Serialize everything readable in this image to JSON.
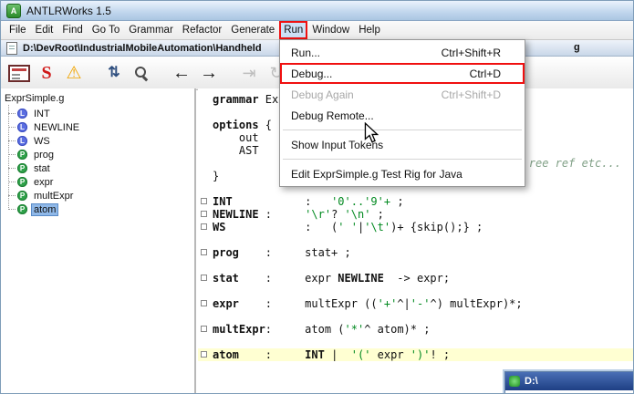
{
  "colors": {
    "annotation_red": "#f01010",
    "selection_blue": "#cde0f6",
    "tree_selection": "#8fb8e8",
    "line_highlight": "#ffffd2",
    "literal_green": "#00891f",
    "comment_green": "#7f9f85",
    "lexer_badge": "#5b6ee1",
    "parser_badge": "#2fa24a"
  },
  "window": {
    "title": "ANTLRWorks 1.5"
  },
  "menubar": {
    "items": [
      "File",
      "Edit",
      "Find",
      "Go To",
      "Grammar",
      "Refactor",
      "Generate",
      "Run",
      "Window",
      "Help"
    ],
    "selected": "Run"
  },
  "pathbar": {
    "path_left": "D:\\DevRoot\\IndustrialMobileAutomation\\Handheld",
    "path_right_fragment": "g"
  },
  "toolbar": {
    "icons": [
      {
        "name": "syntax-diagram-icon",
        "kind": "console"
      },
      {
        "name": "generate-code-icon",
        "kind": "glyph",
        "glyph": "S",
        "cls": "ic-s"
      },
      {
        "name": "warnings-icon",
        "kind": "glyph",
        "glyph": "⚠",
        "cls": "ic-warn"
      },
      {
        "name": "sort-rules-icon",
        "kind": "glyph",
        "glyph": "⇅",
        "cls": "ic-sort",
        "group": true
      },
      {
        "name": "search-icon",
        "kind": "mag"
      },
      {
        "name": "back-icon",
        "kind": "glyph",
        "glyph": "←",
        "cls": "ic-arrow",
        "group": true
      },
      {
        "name": "forward-icon",
        "kind": "glyph",
        "glyph": "→",
        "cls": "ic-arrow"
      },
      {
        "name": "debug-step-icon",
        "kind": "glyph",
        "glyph": "⇥",
        "cls": "ic-dis",
        "disabled": true,
        "group": true
      },
      {
        "name": "debug-rewind-icon",
        "kind": "glyph",
        "glyph": "↻",
        "cls": "ic-dis",
        "disabled": true
      }
    ]
  },
  "run_menu": {
    "items": [
      {
        "label": "Run...",
        "shortcut": "Ctrl+Shift+R"
      },
      {
        "label": "Debug...",
        "shortcut": "Ctrl+D",
        "highlight": true
      },
      {
        "label": "Debug Again",
        "shortcut": "Ctrl+Shift+D",
        "state": "disabled"
      },
      {
        "label": "Debug Remote...",
        "shortcut": ""
      },
      {
        "type": "separator"
      },
      {
        "label": "Show Input Tokens",
        "shortcut": ""
      },
      {
        "type": "separator"
      },
      {
        "label": "Edit ExprSimple.g Test Rig for Java",
        "shortcut": ""
      }
    ]
  },
  "rule_tree": {
    "root": "ExprSimple.g",
    "lexer_badge": "L",
    "parser_badge": "P",
    "items": [
      {
        "label": "INT",
        "kind": "lexer"
      },
      {
        "label": "NEWLINE",
        "kind": "lexer"
      },
      {
        "label": "WS",
        "kind": "lexer"
      },
      {
        "label": "prog",
        "kind": "parser"
      },
      {
        "label": "stat",
        "kind": "parser"
      },
      {
        "label": "expr",
        "kind": "parser"
      },
      {
        "label": "multExpr",
        "kind": "parser"
      },
      {
        "label": "atom",
        "kind": "parser",
        "selected": true
      }
    ]
  },
  "editor": {
    "lines": [
      {
        "segs": [
          {
            "t": "grammar",
            "c": "kw"
          },
          {
            "t": " Expr",
            "c": "pl"
          }
        ]
      },
      {
        "segs": []
      },
      {
        "segs": [
          {
            "t": "options",
            "c": "kw"
          },
          {
            "t": " {",
            "c": "pl"
          }
        ]
      },
      {
        "segs": [
          {
            "t": "    out",
            "c": "pl"
          }
        ]
      },
      {
        "segs": [
          {
            "t": "    AST",
            "c": "pl"
          }
        ]
      },
      {
        "segs": [
          {
            "t": "                                                ree ref etc...",
            "c": "cmt"
          }
        ]
      },
      {
        "segs": [
          {
            "t": "}",
            "c": "pl"
          }
        ]
      },
      {
        "segs": []
      },
      {
        "sq": true,
        "segs": [
          {
            "t": "INT",
            "c": "ref"
          },
          {
            "t": "           :   ",
            "c": "pl"
          },
          {
            "t": "'0'..'9'+",
            "c": "lit"
          },
          {
            "t": " ;",
            "c": "pl"
          }
        ]
      },
      {
        "sq": true,
        "segs": [
          {
            "t": "NEWLINE",
            "c": "ref"
          },
          {
            "t": " :     ",
            "c": "pl"
          },
          {
            "t": "'\\r'",
            "c": "lit"
          },
          {
            "t": "? ",
            "c": "pl"
          },
          {
            "t": "'\\n'",
            "c": "lit"
          },
          {
            "t": " ;",
            "c": "pl"
          }
        ]
      },
      {
        "sq": true,
        "segs": [
          {
            "t": "WS",
            "c": "ref"
          },
          {
            "t": "            :   ",
            "c": "pl"
          },
          {
            "t": "(",
            "c": "pl"
          },
          {
            "t": "' '",
            "c": "lit"
          },
          {
            "t": "|",
            "c": "pl"
          },
          {
            "t": "'\\t'",
            "c": "lit"
          },
          {
            "t": ")+ {skip();} ;",
            "c": "pl"
          }
        ]
      },
      {
        "segs": []
      },
      {
        "sq": true,
        "segs": [
          {
            "t": "prog",
            "c": "ref"
          },
          {
            "t": "    :     ",
            "c": "pl"
          },
          {
            "t": "stat+ ;",
            "c": "pl"
          }
        ]
      },
      {
        "segs": []
      },
      {
        "sq": true,
        "segs": [
          {
            "t": "stat",
            "c": "ref"
          },
          {
            "t": "    :     ",
            "c": "pl"
          },
          {
            "t": "expr ",
            "c": "pl"
          },
          {
            "t": "NEWLINE",
            "c": "ref"
          },
          {
            "t": "  -> expr;",
            "c": "pl"
          }
        ]
      },
      {
        "segs": []
      },
      {
        "sq": true,
        "segs": [
          {
            "t": "expr",
            "c": "ref"
          },
          {
            "t": "    :     ",
            "c": "pl"
          },
          {
            "t": "multExpr ((",
            "c": "pl"
          },
          {
            "t": "'+'",
            "c": "lit"
          },
          {
            "t": "^|",
            "c": "pl"
          },
          {
            "t": "'-'",
            "c": "lit"
          },
          {
            "t": "^) multExpr)*;",
            "c": "pl"
          }
        ]
      },
      {
        "segs": []
      },
      {
        "sq": true,
        "segs": [
          {
            "t": "multExpr",
            "c": "ref"
          },
          {
            "t": ":     ",
            "c": "pl"
          },
          {
            "t": "atom (",
            "c": "pl"
          },
          {
            "t": "'*'",
            "c": "lit"
          },
          {
            "t": "^ atom)* ;",
            "c": "pl"
          }
        ]
      },
      {
        "segs": []
      },
      {
        "sq": true,
        "hl": true,
        "segs": [
          {
            "t": "atom",
            "c": "ref"
          },
          {
            "t": "    :     ",
            "c": "pl"
          },
          {
            "t": "INT",
            "c": "ref"
          },
          {
            "t": " |  ",
            "c": "pl"
          },
          {
            "t": "'('",
            "c": "lit"
          },
          {
            "t": " expr ",
            "c": "pl"
          },
          {
            "t": "')'",
            "c": "lit"
          },
          {
            "t": "! ;",
            "c": "pl"
          }
        ]
      }
    ]
  },
  "background_window": {
    "title": "D:\\"
  }
}
